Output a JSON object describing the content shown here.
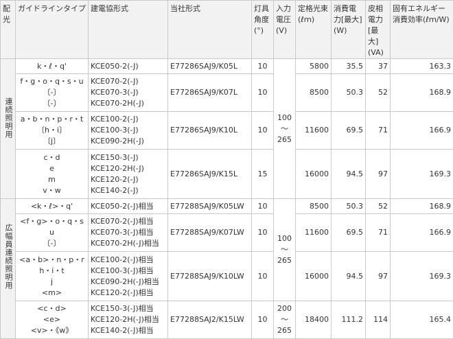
{
  "headers": {
    "light_distribution": "配光",
    "guideline_type": "ガイドラインタイプ",
    "kensetsu_type": "建電協形式",
    "our_model": "当社形式",
    "beam_angle": "灯具角度(°)",
    "input_voltage": "入力電圧(V)",
    "rated_flux": "定格光束(ℓｍ)",
    "power_max": "消費電力[最大](W)",
    "apparent_power": "皮相電力[最大](VA)",
    "efficiency": "固有エネルギー消費効率(ℓｍ/W)"
  },
  "groups": [
    {
      "label": "連続照明用",
      "voltage": [
        "100",
        "～",
        "265"
      ],
      "rows": [
        {
          "guide": [
            "k・ℓ・q'"
          ],
          "kensetsu": [
            "KCE050-2(-J)"
          ],
          "model": "E77286SAJ9/K05L",
          "angle": "10",
          "lumen": "5800",
          "watt": "35.5",
          "va": "37",
          "eff": "163.3"
        },
        {
          "guide": [
            "f・g・o・q・s・u",
            "〔-〕",
            "〔-〕"
          ],
          "kensetsu": [
            "KCE070-2(-J)",
            "KCE070-3(-J)",
            "KCE070-2H(-J)"
          ],
          "model": "E77286SAJ9/K07L",
          "angle": "10",
          "lumen": "8500",
          "watt": "50.3",
          "va": "52",
          "eff": "168.9"
        },
        {
          "guide": [
            "a・b・n・p・r・t",
            "〔h・i〕",
            "〔j〕"
          ],
          "kensetsu": [
            "KCE100-2(-J)",
            "KCE100-3(-J)",
            "KCE090-2H(-J)"
          ],
          "model": "E77286SAJ9/K10L",
          "angle": "10",
          "lumen": "11600",
          "watt": "69.5",
          "va": "71",
          "eff": "166.9"
        },
        {
          "guide": [
            "c・d",
            "e",
            "m",
            "v・w"
          ],
          "kensetsu": [
            "KCE150-3(-J)",
            "KCE120-2H(-J)",
            "KCE120-2(-J)",
            "KCE140-2(-J)"
          ],
          "model": "E77286SAJ9/K15L",
          "angle": "15",
          "lumen": "16000",
          "watt": "94.5",
          "va": "97",
          "eff": "169.3"
        }
      ]
    },
    {
      "label": "広幅員連続照明用",
      "voltage": [
        "100",
        "～",
        "265"
      ],
      "voltage2": [
        "200",
        "～",
        "265"
      ],
      "rows": [
        {
          "guide": [
            "<k・ℓ>・q'"
          ],
          "kensetsu": [
            "KCE050-2(-J)相当"
          ],
          "model": "E77288SAJ9/K05LW",
          "angle": "10",
          "lumen": "8500",
          "watt": "50.3",
          "va": "52",
          "eff": "168.9"
        },
        {
          "guide": [
            "<f・g>・o・q・s",
            "u",
            "〔-〕"
          ],
          "kensetsu": [
            "KCE070-2(-J)相当",
            "KCE070-3(-J)相当",
            "KCE070-2H(-J)相当"
          ],
          "model": "E77288SAJ9/K07LW",
          "angle": "10",
          "lumen": "11600",
          "watt": "69.5",
          "va": "71",
          "eff": "166.9"
        },
        {
          "guide": [
            "<a・b>・n・p・r",
            "h・i・t",
            "j",
            "<m>"
          ],
          "kensetsu": [
            "KCE100-2(-J)相当",
            "KCE100-3(-J)相当",
            "KCE090-2H(-J)相当",
            "KCE120-2(-J)相当"
          ],
          "model": "E77288SAJ9/K10LW",
          "angle": "10",
          "lumen": "16000",
          "watt": "94.5",
          "va": "97",
          "eff": "169.3"
        },
        {
          "guide": [
            "<c・d>",
            "<e>",
            "<v>・《w》"
          ],
          "kensetsu": [
            "KCE150-3(-J)相当",
            "KCE120-2H(-J)相当",
            "KCE140-2(-J)相当"
          ],
          "model": "E77288SAJ2/K15LW",
          "angle": "10",
          "lumen": "18400",
          "watt": "111.2",
          "va": "114",
          "eff": "165.4"
        }
      ]
    }
  ]
}
